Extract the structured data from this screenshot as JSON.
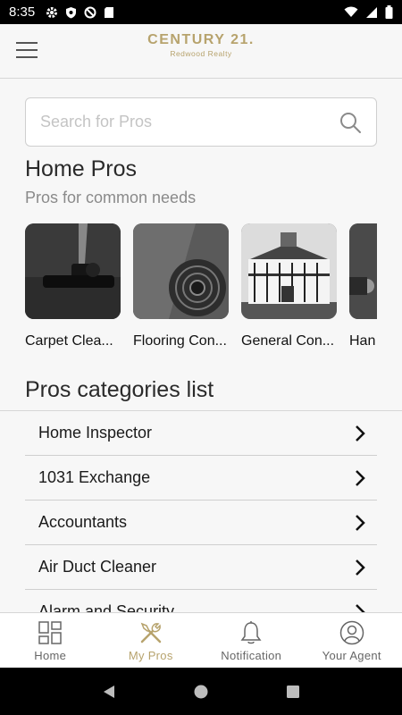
{
  "status_bar": {
    "time": "8:35"
  },
  "header": {
    "brand_name": "CENTURY 21.",
    "brand_sub": "Redwood Realty"
  },
  "search": {
    "placeholder": "Search for Pros"
  },
  "home_pros": {
    "title": "Home Pros",
    "subtitle": "Pros for common needs",
    "items": [
      {
        "label": "Carpet Clea...",
        "image": "carpet-cleaner-photo"
      },
      {
        "label": "Flooring Con...",
        "image": "flooring-roll-photo"
      },
      {
        "label": "General Con...",
        "image": "house-photo"
      },
      {
        "label": "Han",
        "image": "tools-photo"
      }
    ]
  },
  "categories": {
    "title": "Pros categories list",
    "items": [
      {
        "label": "Home Inspector"
      },
      {
        "label": "1031 Exchange"
      },
      {
        "label": "Accountants"
      },
      {
        "label": "Air Duct Cleaner"
      },
      {
        "label": "Alarm and Security"
      }
    ]
  },
  "bottom_nav": {
    "items": [
      {
        "label": "Home",
        "icon": "grid-icon",
        "active": false
      },
      {
        "label": "My Pros",
        "icon": "tools-icon",
        "active": true
      },
      {
        "label": "Notification",
        "icon": "bell-icon",
        "active": false
      },
      {
        "label": "Your Agent",
        "icon": "person-icon",
        "active": false
      }
    ]
  },
  "colors": {
    "accent": "#b7a36d",
    "text": "#222222",
    "muted": "#8a8a8a"
  }
}
